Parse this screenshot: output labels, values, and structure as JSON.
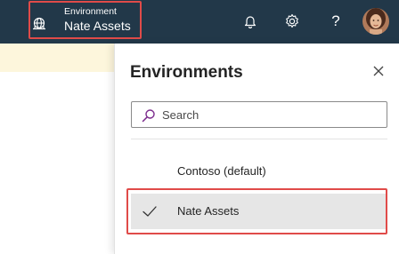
{
  "header": {
    "environment_caption": "Environment",
    "environment_name": "Nate Assets",
    "icons": {
      "environment": "globe-icon",
      "notifications": "bell-icon",
      "settings": "gear-icon",
      "help": "question-mark-icon",
      "account": "user-avatar"
    },
    "help_glyph": "?"
  },
  "panel": {
    "title": "Environments",
    "search": {
      "placeholder": "Search",
      "value": ""
    },
    "environments": [
      {
        "label": "Contoso (default)",
        "selected": false
      },
      {
        "label": "Nate Assets",
        "selected": true
      }
    ]
  },
  "colors": {
    "topbar": "#223849",
    "highlight_border": "#e04b49",
    "notice_strip": "#fdf6dc",
    "selected_row": "#e6e6e6",
    "search_icon": "#7b2a8c"
  }
}
